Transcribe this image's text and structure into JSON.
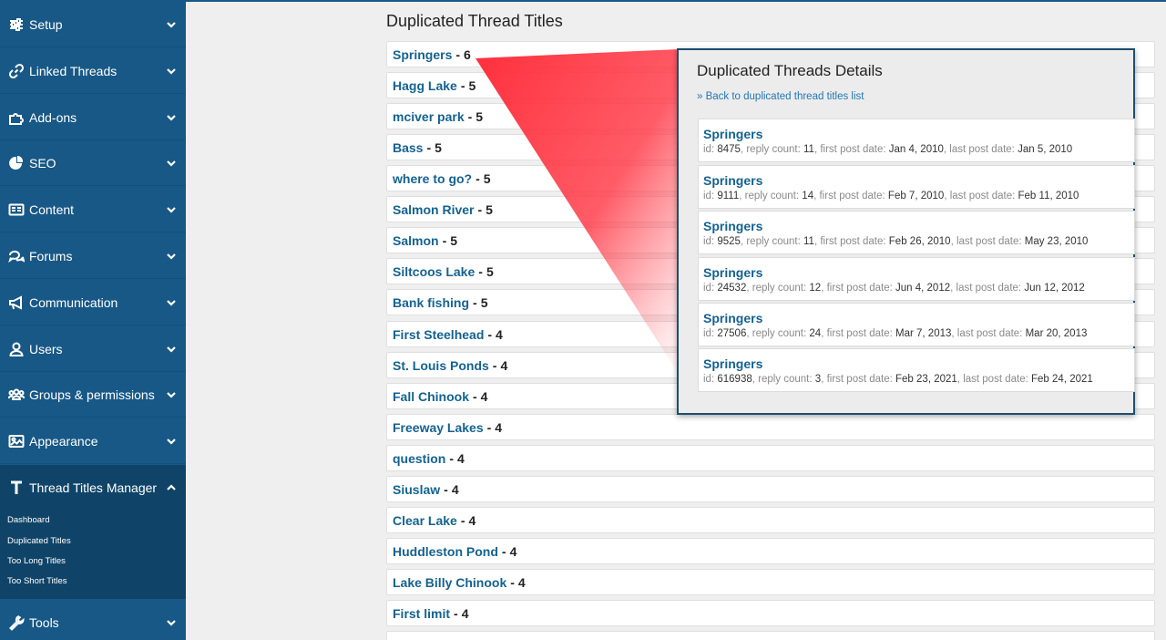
{
  "sidebar": {
    "items": [
      {
        "label": "Setup",
        "icon": "sliders-icon"
      },
      {
        "label": "Linked Threads",
        "icon": "link-icon"
      },
      {
        "label": "Add-ons",
        "icon": "puzzle-icon"
      },
      {
        "label": "SEO",
        "icon": "pie-chart-icon"
      },
      {
        "label": "Content",
        "icon": "content-icon"
      },
      {
        "label": "Forums",
        "icon": "comments-icon"
      },
      {
        "label": "Communication",
        "icon": "megaphone-icon"
      },
      {
        "label": "Users",
        "icon": "user-icon"
      },
      {
        "label": "Groups & permissions",
        "icon": "users-icon"
      },
      {
        "label": "Appearance",
        "icon": "image-icon"
      },
      {
        "label": "Thread Titles Manager",
        "icon": "text-t-icon"
      },
      {
        "label": "Tools",
        "icon": "wrench-icon"
      }
    ],
    "submenu": [
      "Dashboard",
      "Duplicated Titles",
      "Too Long Titles",
      "Too Short Titles"
    ]
  },
  "main": {
    "title": "Duplicated Thread Titles",
    "rows": [
      {
        "title": "Springers",
        "count": "6"
      },
      {
        "title": "Hagg Lake",
        "count": "5"
      },
      {
        "title": "mciver park",
        "count": "5"
      },
      {
        "title": "Bass",
        "count": "5"
      },
      {
        "title": "where to go?",
        "count": "5"
      },
      {
        "title": "Salmon River",
        "count": "5"
      },
      {
        "title": "Salmon",
        "count": "5"
      },
      {
        "title": "Siltcoos Lake",
        "count": "5"
      },
      {
        "title": "Bank fishing",
        "count": "5"
      },
      {
        "title": "First Steelhead",
        "count": "4"
      },
      {
        "title": "St. Louis Ponds",
        "count": "4"
      },
      {
        "title": "Fall Chinook",
        "count": "4"
      },
      {
        "title": "Freeway Lakes",
        "count": "4"
      },
      {
        "title": "question",
        "count": "4"
      },
      {
        "title": "Siuslaw",
        "count": "4"
      },
      {
        "title": "Clear Lake",
        "count": "4"
      },
      {
        "title": "Huddleston Pond",
        "count": "4"
      },
      {
        "title": "Lake Billy Chinook",
        "count": "4"
      },
      {
        "title": "First limit",
        "count": "4"
      }
    ]
  },
  "panel": {
    "title": "Duplicated Threads Details",
    "back_link": "» Back to duplicated thread titles list",
    "labels": {
      "id": "id:",
      "reply": "reply count:",
      "first": "first post date:",
      "last": "last post date:"
    },
    "threads": [
      {
        "title": "Springers",
        "id": "8475",
        "reply_count": "11",
        "first_post": "Jan 4, 2010",
        "last_post": "Jan 5, 2010"
      },
      {
        "title": "Springers",
        "id": "9111",
        "reply_count": "14",
        "first_post": "Feb 7, 2010",
        "last_post": "Feb 11, 2010"
      },
      {
        "title": "Springers",
        "id": "9525",
        "reply_count": "11",
        "first_post": "Feb 26, 2010",
        "last_post": "May 23, 2010"
      },
      {
        "title": "Springers",
        "id": "24532",
        "reply_count": "12",
        "first_post": "Jun 4, 2012",
        "last_post": "Jun 12, 2012"
      },
      {
        "title": "Springers",
        "id": "27506",
        "reply_count": "24",
        "first_post": "Mar 7, 2013",
        "last_post": "Mar 20, 2013"
      },
      {
        "title": "Springers",
        "id": "616938",
        "reply_count": "3",
        "first_post": "Feb 23, 2021",
        "last_post": "Feb 24, 2021"
      }
    ]
  },
  "colors": {
    "sidebar": "#185886",
    "sidebar_active": "#0f4468",
    "link": "#15628f",
    "highlight": "#ff3040"
  }
}
